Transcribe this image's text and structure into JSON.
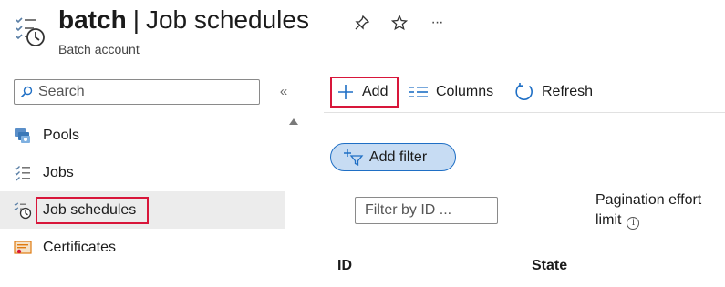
{
  "header": {
    "resource_name": "batch",
    "separator": "|",
    "page_title": "Job schedules",
    "subtitle": "Batch account",
    "icons": [
      "job-schedule-icon",
      "pin-icon",
      "star-icon",
      "more-icon"
    ],
    "more_glyph": "···"
  },
  "sidebar": {
    "search_placeholder": "Search",
    "collapse_glyph": "«",
    "items": [
      {
        "label": "Pools",
        "icon": "pools-icon",
        "active": false
      },
      {
        "label": "Jobs",
        "icon": "jobs-icon",
        "active": false
      },
      {
        "label": "Job schedules",
        "icon": "job-schedule-icon",
        "active": true
      },
      {
        "label": "Certificates",
        "icon": "certificate-icon",
        "active": false
      }
    ]
  },
  "toolbar": {
    "add_label": "Add",
    "columns_label": "Columns",
    "refresh_label": "Refresh"
  },
  "filters": {
    "add_filter_label": "Add filter",
    "id_filter_placeholder": "Filter by ID ...",
    "pagination_label": "Pagination effort limit",
    "info_glyph": "i"
  },
  "table": {
    "columns": [
      "ID",
      "State"
    ]
  },
  "colors": {
    "highlight_border": "#d8163a",
    "accent": "#1f6fc5",
    "filter_fill": "#c7dcf3",
    "active_nav_bg": "#ececec"
  }
}
